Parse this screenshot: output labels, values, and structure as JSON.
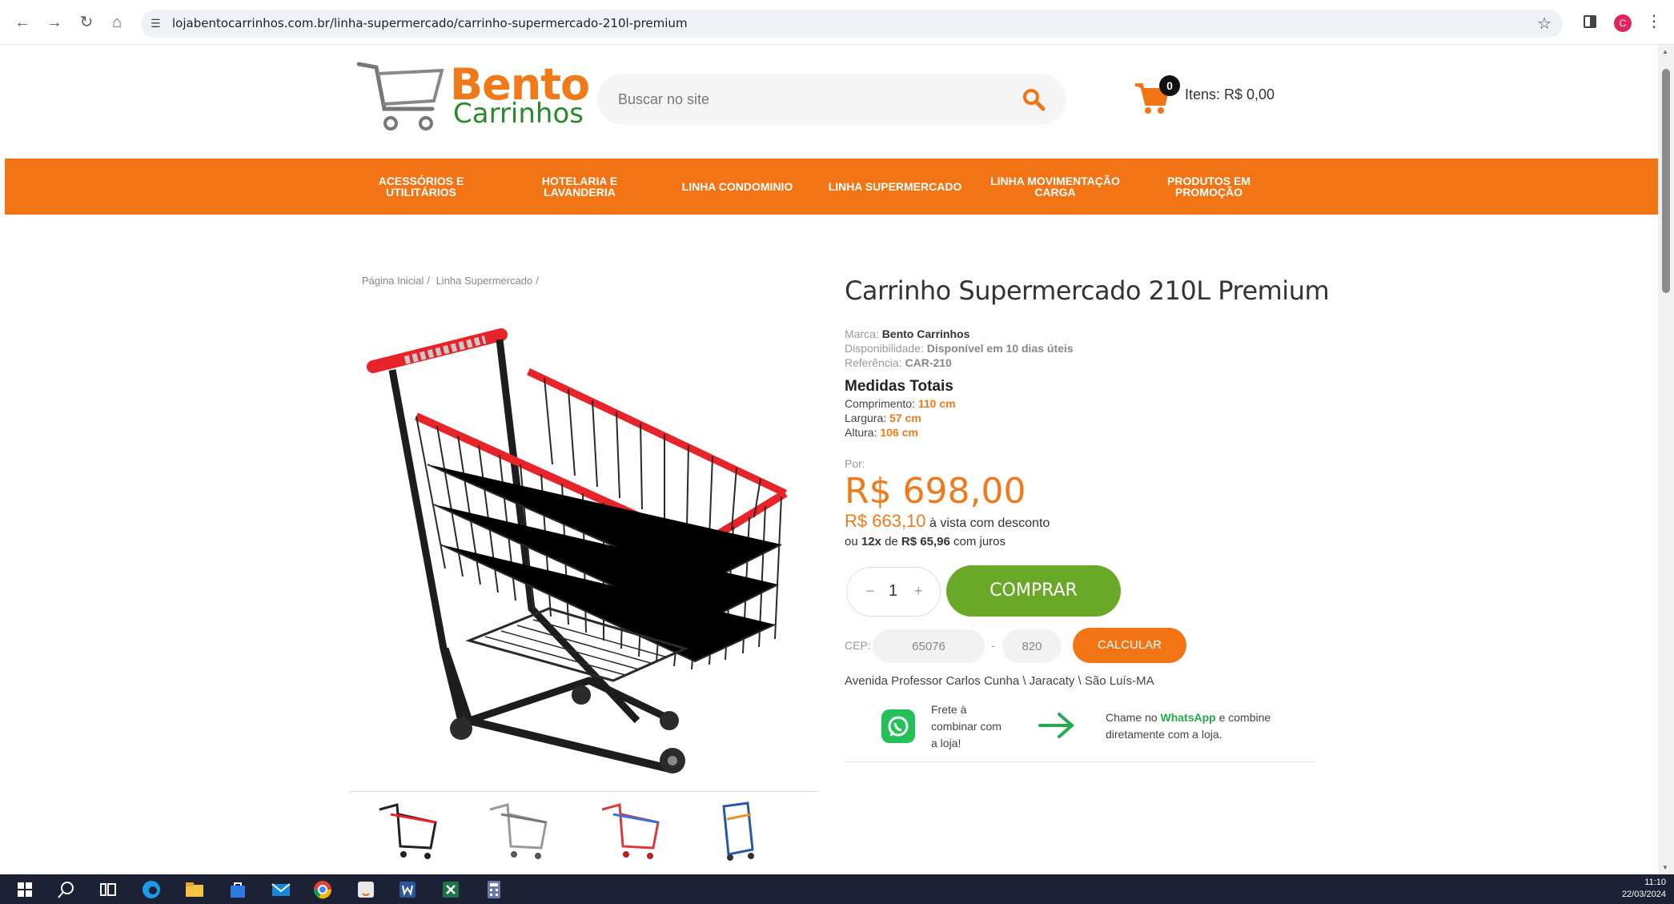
{
  "browser": {
    "url": "lojabentocarrinhos.com.br/linha-supermercado/carrinho-supermercado-210l-premium",
    "profile_initial": "C"
  },
  "header": {
    "logo_line1": "Bento",
    "logo_line2": "Carrinhos",
    "search_placeholder": "Buscar no site",
    "cart_count": "0",
    "cart_label": "Itens: R$ 0,00"
  },
  "nav": {
    "items": [
      {
        "label_line1": "ACESSÓRIOS E",
        "label_line2": "UTILITÁRIOS"
      },
      {
        "label_line1": "HOTELARIA E",
        "label_line2": "LAVANDERIA"
      },
      {
        "label_line1": "LINHA CONDOMINIO",
        "label_line2": ""
      },
      {
        "label_line1": "LINHA SUPERMERCADO",
        "label_line2": ""
      },
      {
        "label_line1": "LINHA MOVIMENTAÇÃO",
        "label_line2": "CARGA"
      },
      {
        "label_line1": "PRODUTOS EM",
        "label_line2": "PROMOÇÃO"
      }
    ]
  },
  "breadcrumb": {
    "home": "Página Inicial",
    "category": "Linha Supermercado",
    "sep": "/"
  },
  "product": {
    "title": "Carrinho Supermercado 210L Premium",
    "brand_label": "Marca:",
    "brand": "Bento Carrinhos",
    "availability_label": "Disponibilidade:",
    "availability": "Disponível em 10 dias úteis",
    "ref_label": "Referência:",
    "ref": "CAR-210",
    "measures_title": "Medidas Totais",
    "length_label": "Comprimento:",
    "length": "110 cm",
    "width_label": "Largura:",
    "width": "57 cm",
    "height_label": "Altura:",
    "height": "106 cm",
    "por_label": "Por:",
    "price": "R$ 698,00",
    "cash_price": "R$ 663,10",
    "cash_text": "à vista com desconto",
    "inst_prefix": "ou",
    "inst_count": "12x",
    "inst_de": "de",
    "inst_value": "R$ 65,96",
    "inst_suffix": "com juros",
    "qty_minus": "−",
    "qty_value": "1",
    "qty_plus": "+",
    "buy_label": "COMPRAR",
    "cep_label": "CEP:",
    "cep_part1": "65076",
    "cep_dash": "-",
    "cep_part2": "820",
    "calc_label": "CALCULAR",
    "address": "Avenida Professor Carlos Cunha \\ Jaracaty \\ São Luís-MA",
    "frete_text": "Frete à combinar com a loja!",
    "chame_prefix": "Chame no",
    "chame_wa": "WhatsApp",
    "chame_suffix": "e combine diretamente com a loja."
  },
  "colors": {
    "brand_orange": "#f27414",
    "buy_green": "#6aa827",
    "whatsapp_green": "#25c05a"
  },
  "taskbar": {
    "time": "11:10",
    "date": "22/03/2024"
  }
}
